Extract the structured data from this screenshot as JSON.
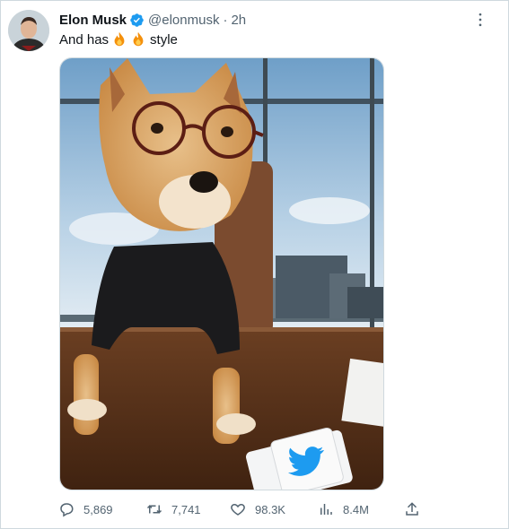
{
  "tweet": {
    "author_name": "Elon Musk",
    "handle": "@elonmusk",
    "separator": "·",
    "time": "2h",
    "text_before": "And has",
    "text_after": "style",
    "emoji": "fire-emoji"
  },
  "media": {
    "description_icons": [
      "twitter-bird-icon"
    ]
  },
  "actions": {
    "replies": "5,869",
    "retweets": "7,741",
    "likes": "98.3K",
    "views": "8.4M"
  },
  "colors": {
    "verified_badge": "#1d9bf0",
    "secondary_text": "#536471",
    "twitter_blue": "#1d9bf0"
  }
}
